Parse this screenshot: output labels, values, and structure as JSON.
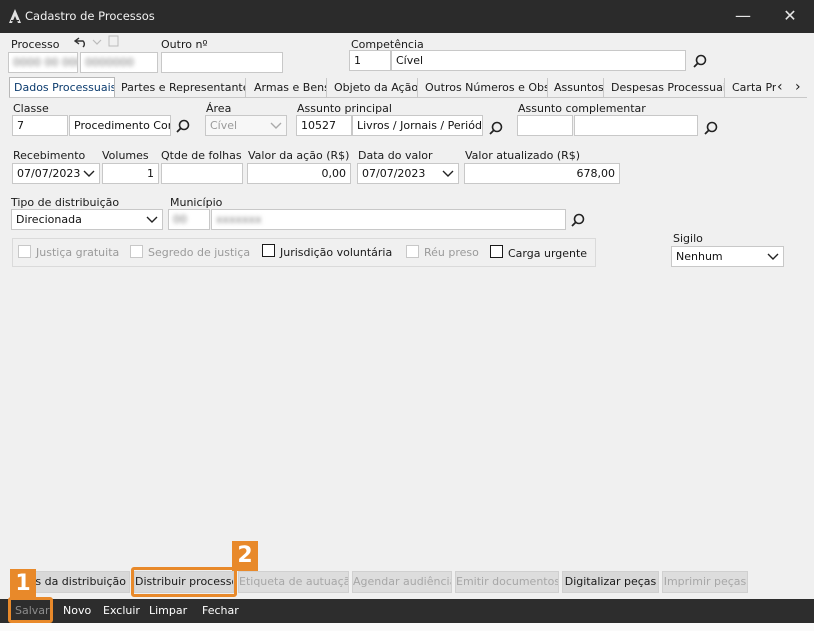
{
  "window": {
    "title": "Cadastro de Processos",
    "minimize": "—",
    "close": "✕"
  },
  "header": {
    "processo_label": "Processo",
    "outro_label": "Outro nº",
    "competencia_label": "Competência",
    "competencia_code": "1",
    "competencia_name": "Cível"
  },
  "tabs": [
    {
      "label": "Dados Processuais"
    },
    {
      "label": "Partes e Representantes"
    },
    {
      "label": "Armas e Bens"
    },
    {
      "label": "Objeto da Ação"
    },
    {
      "label": "Outros Números e Obs."
    },
    {
      "label": "Assuntos"
    },
    {
      "label": "Despesas Processuais"
    },
    {
      "label": "Carta Pr"
    }
  ],
  "tab_scroll": {
    "left": "‹",
    "right": "›"
  },
  "form": {
    "classe_label": "Classe",
    "classe_code": "7",
    "classe_name": "Procedimento Com",
    "area_label": "Área",
    "area_value": "Cível",
    "assunto_label": "Assunto principal",
    "assunto_code": "10527",
    "assunto_name": "Livros / Jornais / Periódic",
    "assunto_comp_label": "Assunto complementar",
    "recebimento_label": "Recebimento",
    "recebimento_value": "07/07/2023",
    "volumes_label": "Volumes",
    "volumes_value": "1",
    "folhas_label": "Qtde de folhas",
    "valor_acao_label": "Valor da ação (R$)",
    "valor_acao_value": "0,00",
    "data_valor_label": "Data do valor",
    "data_valor_value": "07/07/2023",
    "valor_atual_label": "Valor atualizado (R$)",
    "valor_atual_value": "678,00",
    "tipo_dist_label": "Tipo de distribuição",
    "tipo_dist_value": "Direcionada",
    "municipio_label": "Município",
    "sigilo_label": "Sigilo",
    "sigilo_value": "Nenhum"
  },
  "checkboxes": [
    {
      "label": "Justiça gratuita",
      "enabled": false,
      "checked": false
    },
    {
      "label": "Segredo de justiça",
      "enabled": false,
      "checked": false
    },
    {
      "label": "Jurisdição voluntária",
      "enabled": true,
      "checked": false
    },
    {
      "label": "Réu preso",
      "enabled": false,
      "checked": false
    },
    {
      "label": "Carga urgente",
      "enabled": true,
      "checked": false
    }
  ],
  "actions": {
    "dados_dist": "os da distribuição",
    "distribuir": "Distribuir processo",
    "etiqueta": "Etiqueta de autuação",
    "agendar": "Agendar audiência",
    "emitir": "Emitir documentos",
    "digitalizar": "Digitalizar peças",
    "imprimir": "Imprimir peças"
  },
  "toolbar": {
    "salvar": "Salvar",
    "novo": "Novo",
    "excluir": "Excluir",
    "limpar": "Limpar",
    "fechar": "Fechar"
  },
  "annotations": {
    "badge1": "1",
    "badge2": "2",
    "color": "#e8892a"
  }
}
